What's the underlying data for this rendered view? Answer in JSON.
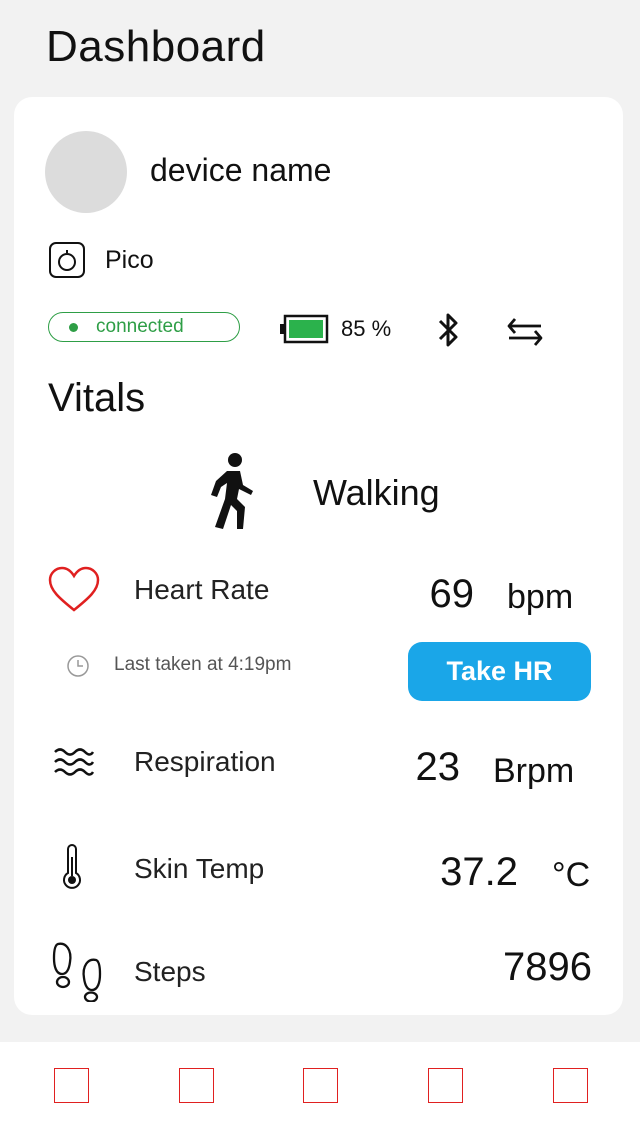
{
  "header": {
    "title": "Dashboard"
  },
  "device": {
    "name": "device name",
    "model": "Pico",
    "status": "connected",
    "battery": "85 %",
    "battery_level": 0.85
  },
  "vitals": {
    "title": "Vitals",
    "activity": "Walking",
    "heart_rate": {
      "label": "Heart Rate",
      "value": "69",
      "unit": "bpm",
      "last_taken": "Last taken at 4:19pm",
      "button": "Take HR"
    },
    "respiration": {
      "label": "Respiration",
      "value": "23",
      "unit": "Brpm"
    },
    "skin_temp": {
      "label": "Skin Temp",
      "value": "37.2",
      "unit": "°C"
    },
    "steps": {
      "label": "Steps",
      "value": "7896"
    }
  },
  "colors": {
    "accent": "#1aa6e8",
    "connected": "#2e9e46",
    "heart": "#e02020",
    "nav": "#e02020"
  },
  "nav": {
    "items": [
      "nav-1-icon",
      "nav-2-icon",
      "nav-3-icon",
      "nav-4-icon",
      "nav-5-icon"
    ]
  }
}
